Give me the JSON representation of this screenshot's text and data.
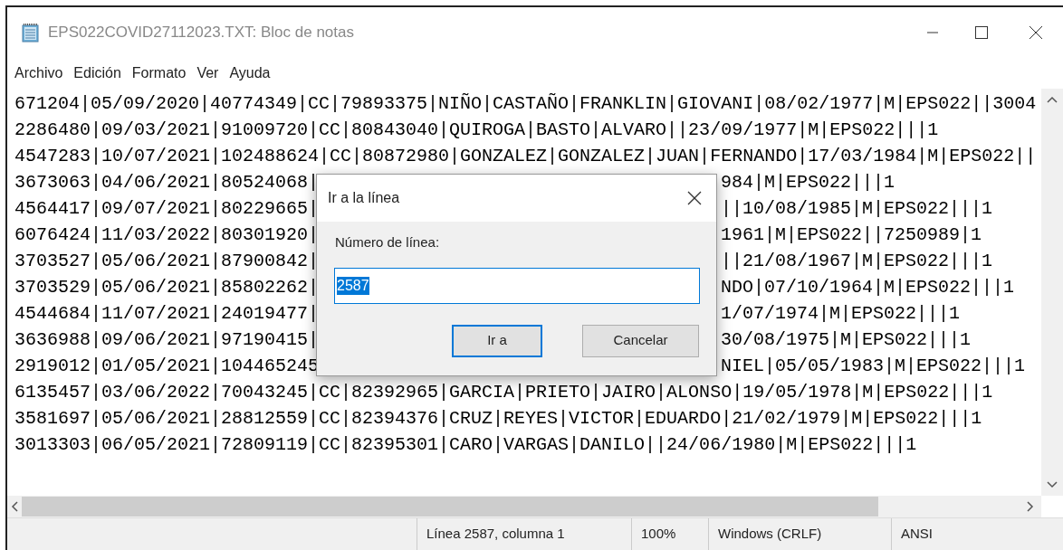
{
  "window": {
    "title": "EPS022COVID27112023.TXT: Bloc de notas"
  },
  "menu": [
    "Archivo",
    "Edición",
    "Formato",
    "Ver",
    "Ayuda"
  ],
  "editor": {
    "lines": [
      {
        "kind": "full",
        "text": "671204|05/09/2020|40774349|CC|79893375|NIÑO|CASTAÑO|FRANKLIN|GIOVANI|08/02/1977|M|EPS022||3004"
      },
      {
        "kind": "full",
        "text": "2286480|09/03/2021|91009720|CC|80843040|QUIROGA|BASTO|ALVARO||23/09/1977|M|EPS022|||1"
      },
      {
        "kind": "full",
        "text": "4547283|10/07/2021|102488624|CC|80872980|GONZALEZ|GONZALEZ|JUAN|FERNANDO|17/03/1984|M|EPS022||"
      },
      {
        "kind": "split",
        "left": "3673063|04/06/2021|80524068|",
        "right": "984|M|EPS022|||1"
      },
      {
        "kind": "split",
        "left": "4564417|09/07/2021|80229665|",
        "right": "||10/08/1985|M|EPS022|||1"
      },
      {
        "kind": "split",
        "left": "6076424|11/03/2022|80301920|",
        "right": "1961|M|EPS022||7250989|1"
      },
      {
        "kind": "split",
        "left": "3703527|05/06/2021|87900842|",
        "right": "||21/08/1967|M|EPS022|||1"
      },
      {
        "kind": "split",
        "left": "3703529|05/06/2021|85802262|",
        "right": "NDO|07/10/1964|M|EPS022|||1"
      },
      {
        "kind": "split",
        "left": "4544684|11/07/2021|24019477|",
        "right": "1/07/1974|M|EPS022|||1"
      },
      {
        "kind": "split",
        "left": "3636988|09/06/2021|97190415|",
        "right": "30/08/1975|M|EPS022|||1"
      },
      {
        "kind": "split",
        "left": "2919012|01/05/2021|104465245",
        "right": "NIEL|05/05/1983|M|EPS022|||1"
      },
      {
        "kind": "full",
        "text": "6135457|03/06/2022|70043245|CC|82392965|GARCIA|PRIETO|JAIRO|ALONSO|19/05/1978|M|EPS022|||1"
      },
      {
        "kind": "full",
        "text": "3581697|05/06/2021|28812559|CC|82394376|CRUZ|REYES|VICTOR|EDUARDO|21/02/1979|M|EPS022|||1"
      },
      {
        "kind": "full",
        "text": "3013303|06/05/2021|72809119|CC|82395301|CARO|VARGAS|DANILO||24/06/1980|M|EPS022|||1"
      }
    ]
  },
  "dialog": {
    "title": "Ir a la línea",
    "label": "Número de línea:",
    "input": {
      "value": "2587",
      "selected": true
    },
    "buttons": [
      {
        "label": "Ir a",
        "default": true
      },
      {
        "label": "Cancelar",
        "default": false
      }
    ]
  },
  "status_bar": [
    "Línea 2587, columna 1",
    "100%",
    "Windows (CRLF)",
    "ANSI"
  ]
}
